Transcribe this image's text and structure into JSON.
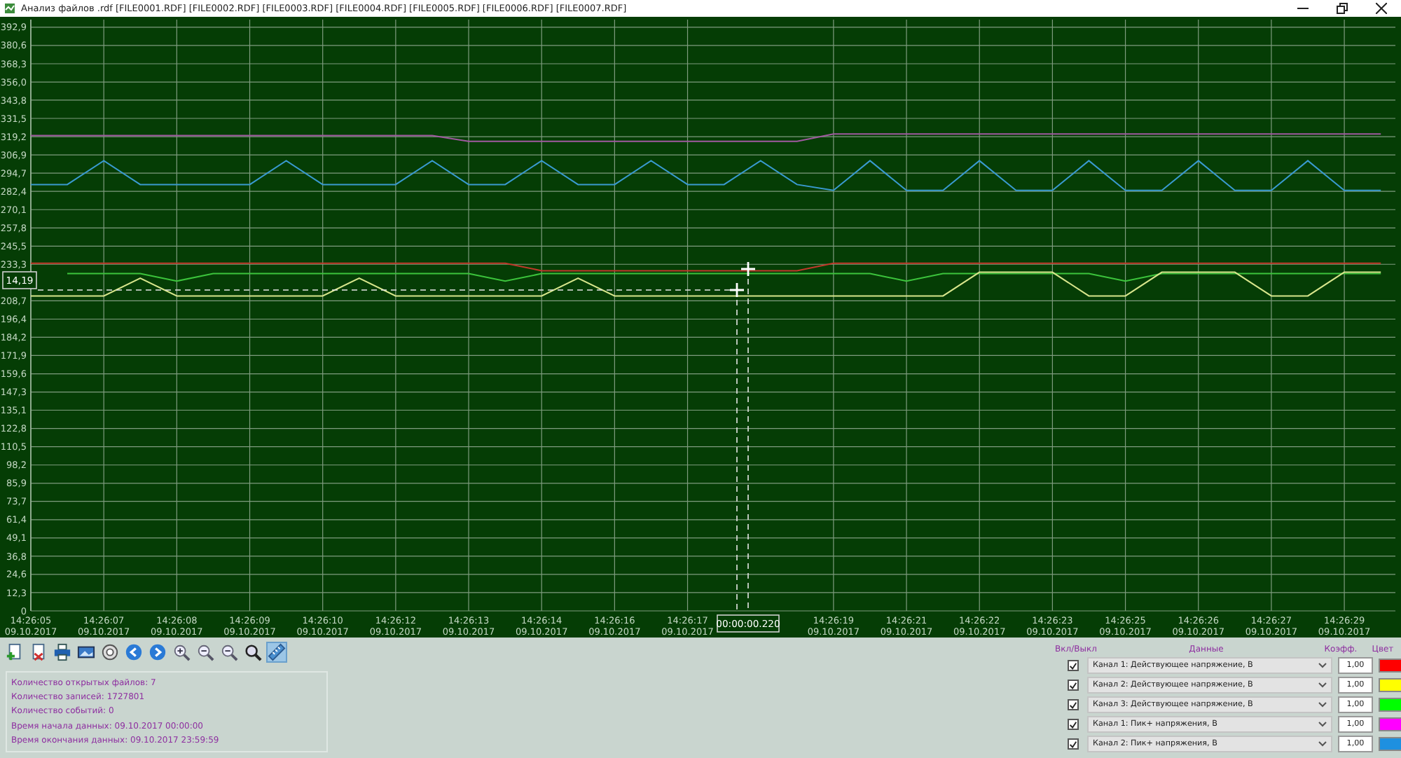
{
  "window": {
    "title": "Анализ файлов .rdf [FILE0001.RDF] [FILE0002.RDF] [FILE0003.RDF] [FILE0004.RDF] [FILE0005.RDF] [FILE0006.RDF] [FILE0007.RDF]"
  },
  "chart": {
    "chart_data": {
      "type": "line",
      "categories": [
        "14:26:05\n09.10.2017",
        null,
        "14:26:07\n09.10.2017",
        null,
        "14:26:08\n09.10.2017",
        null,
        "14:26:09\n09.10.2017",
        null,
        "14:26:10\n09.10.2017",
        null,
        "14:26:12\n09.10.2017",
        null,
        "14:26:13\n09.10.2017",
        null,
        "14:26:14\n09.10.2017",
        null,
        "14:26:16\n09.10.2017",
        null,
        "14:26:17\n09.10.2017",
        null,
        null,
        null,
        "14:26:19\n09.10.2017",
        null,
        "14:26:21\n09.10.2017",
        null,
        "14:26:22\n09.10.2017",
        null,
        "14:26:23\n09.10.2017",
        null,
        "14:26:25\n09.10.2017",
        null,
        "14:26:26\n09.10.2017",
        null,
        "14:26:27\n09.10.2017",
        null,
        "14:26:29\n09.10.2017",
        null
      ],
      "series": [
        {
          "color": "#a05aa0",
          "values": [
            320,
            320,
            320,
            320,
            320,
            320,
            320,
            320,
            320,
            320,
            320,
            320,
            316,
            316,
            316,
            316,
            316,
            316,
            316,
            316,
            316,
            316,
            321,
            321,
            321,
            321,
            321,
            321,
            321,
            321,
            321,
            321,
            321,
            321,
            321,
            321,
            321,
            321
          ]
        },
        {
          "color": "#3a9ad0",
          "values": [
            287,
            287,
            303,
            287,
            287,
            287,
            287,
            303,
            287,
            287,
            287,
            303,
            287,
            287,
            303,
            287,
            287,
            303,
            287,
            287,
            303,
            287,
            283,
            303,
            283,
            283,
            303,
            283,
            283,
            303,
            283,
            283,
            303,
            283,
            283,
            303,
            283,
            283
          ]
        },
        {
          "color": "#c0392b",
          "values": [
            234,
            234,
            234,
            234,
            234,
            234,
            234,
            234,
            234,
            234,
            234,
            234,
            234,
            234,
            229,
            229,
            229,
            229,
            229,
            229,
            229,
            229,
            234,
            234,
            234,
            234,
            234,
            234,
            234,
            234,
            234,
            234,
            234,
            234,
            234,
            234,
            234,
            234
          ]
        },
        {
          "color": "#3cc43c",
          "values": [
            null,
            227,
            227,
            227,
            222,
            227,
            227,
            227,
            227,
            227,
            227,
            227,
            227,
            222,
            227,
            227,
            227,
            227,
            227,
            227,
            227,
            227,
            227,
            227,
            222,
            227,
            227,
            227,
            227,
            227,
            222,
            227,
            227,
            227,
            227,
            227,
            227,
            227
          ]
        },
        {
          "color": "#d8e68c",
          "values": [
            212,
            212,
            212,
            224,
            212,
            212,
            212,
            212,
            212,
            224,
            212,
            212,
            212,
            212,
            212,
            224,
            212,
            212,
            212,
            212,
            212,
            212,
            212,
            212,
            212,
            212,
            228,
            228,
            228,
            212,
            212,
            228,
            228,
            228,
            212,
            212,
            228,
            228
          ]
        }
      ],
      "ylim": [
        0,
        398
      ],
      "grid": true,
      "yticks": [
        {
          "value": 0,
          "label": "0"
        },
        {
          "value": 12.3,
          "label": "12,3"
        },
        {
          "value": 24.6,
          "label": "24,6"
        },
        {
          "value": 36.8,
          "label": "36,8"
        },
        {
          "value": 49.1,
          "label": "49,1"
        },
        {
          "value": 61.4,
          "label": "61,4"
        },
        {
          "value": 73.7,
          "label": "73,7"
        },
        {
          "value": 85.9,
          "label": "85,9"
        },
        {
          "value": 98.2,
          "label": "98,2"
        },
        {
          "value": 110.5,
          "label": "110,5"
        },
        {
          "value": 122.8,
          "label": "122,8"
        },
        {
          "value": 135.1,
          "label": "135,1"
        },
        {
          "value": 147.3,
          "label": "147,3"
        },
        {
          "value": 159.6,
          "label": "159,6"
        },
        {
          "value": 171.9,
          "label": "171,9"
        },
        {
          "value": 184.2,
          "label": "184,2"
        },
        {
          "value": 196.4,
          "label": "196,4"
        },
        {
          "value": 208.7,
          "label": "208,7"
        },
        {
          "value": 233.3,
          "label": "233,3"
        },
        {
          "value": 245.5,
          "label": "245,5"
        },
        {
          "value": 257.8,
          "label": "257,8"
        },
        {
          "value": 270.1,
          "label": "270,1"
        },
        {
          "value": 282.4,
          "label": "282,4"
        },
        {
          "value": 294.7,
          "label": "294,7"
        },
        {
          "value": 306.9,
          "label": "306,9"
        },
        {
          "value": 319.2,
          "label": "319,2"
        },
        {
          "value": 331.5,
          "label": "331,5"
        },
        {
          "value": 343.8,
          "label": "343,8"
        },
        {
          "value": 356.0,
          "label": "356,0"
        },
        {
          "value": 368.3,
          "label": "368,3"
        },
        {
          "value": 380.6,
          "label": "380,6"
        },
        {
          "value": 392.9,
          "label": "392,9"
        }
      ]
    },
    "cursor": {
      "value_label": "14,19",
      "time_label": "00:00:00.220"
    }
  },
  "toolbar": [
    {
      "kind": "add-file",
      "selected": false
    },
    {
      "kind": "delete-file",
      "selected": false
    },
    {
      "kind": "print",
      "selected": false
    },
    {
      "kind": "image",
      "selected": false
    },
    {
      "kind": "settings",
      "selected": false
    },
    {
      "kind": "back",
      "selected": false
    },
    {
      "kind": "forward",
      "selected": false
    },
    {
      "kind": "zoom-in",
      "selected": false
    },
    {
      "kind": "zoom-out",
      "selected": false
    },
    {
      "kind": "zoom-out",
      "selected": false
    },
    {
      "kind": "zoom-fit",
      "selected": false
    },
    {
      "kind": "ruler",
      "selected": true
    }
  ],
  "info": [
    "Количество открытых файлов: 7",
    "Количество записей: 1727801",
    "Количество событий: 0",
    "Время начала данных: 09.10.2017 00:00:00",
    "Время окончания данных: 09.10.2017 23:59:59"
  ],
  "channels": {
    "columns": [
      "Вкл/Выкл",
      "Данные",
      "Коэфф.",
      "Цвет"
    ],
    "rows": [
      {
        "enabled": true,
        "data": "Канал 1: Действующее напряжение, В",
        "coef": "1,00",
        "color": "#ff0000"
      },
      {
        "enabled": true,
        "data": "Канал 2: Действующее напряжение, В",
        "coef": "1,00",
        "color": "#ffff00"
      },
      {
        "enabled": true,
        "data": "Канал 3: Действующее напряжение, В",
        "coef": "1,00",
        "color": "#00ff00"
      },
      {
        "enabled": true,
        "data": "Канал 1: Пик+ напряжения, В",
        "coef": "1,00",
        "color": "#ff00ff"
      },
      {
        "enabled": true,
        "data": "Канал 2: Пик+ напряжения, В",
        "coef": "1,00",
        "color": "#1e90e0"
      }
    ]
  }
}
